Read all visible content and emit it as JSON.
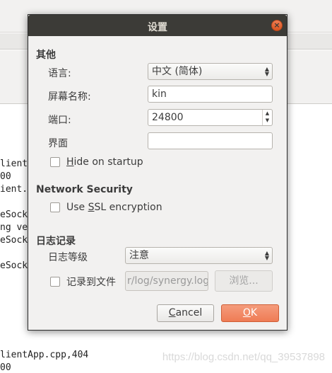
{
  "background": {
    "log_lines": [
      "lientApp.cpp,404"
    ],
    "partial_lines": [
      "lient",
      "00",
      "ient.",
      "eSock",
      "ng ve",
      "eSock",
      "eSock",
      "00"
    ],
    "watermark": "https://blog.csdn.net/qq_39537898"
  },
  "dialog": {
    "title": "设置",
    "close_icon": "close-icon",
    "other_section": "其他",
    "language_label": "语言:",
    "language_value": "中文 (简体)",
    "screen_name_label": "屏幕名称:",
    "screen_name_value": "kin",
    "port_label": "端口:",
    "port_value": "24800",
    "interface_label": "界面",
    "interface_value": "",
    "hide_on_startup": {
      "label_pre": "",
      "label_u": "H",
      "label_post": "ide on startup",
      "checked": false
    },
    "network_security_section": "Network Security",
    "use_ssl": {
      "label_pre": "Use ",
      "label_u": "S",
      "label_post": "SL encryption",
      "checked": false
    },
    "logging_section": "日志记录",
    "log_level_label": "日志等级",
    "log_level_value": "注意",
    "log_to_file_label": "记录到文件",
    "log_to_file_checked": false,
    "log_path_value": "r/log/synergy.log",
    "browse_label": "浏览...",
    "cancel_label": "Cancel",
    "ok_label": "OK"
  }
}
